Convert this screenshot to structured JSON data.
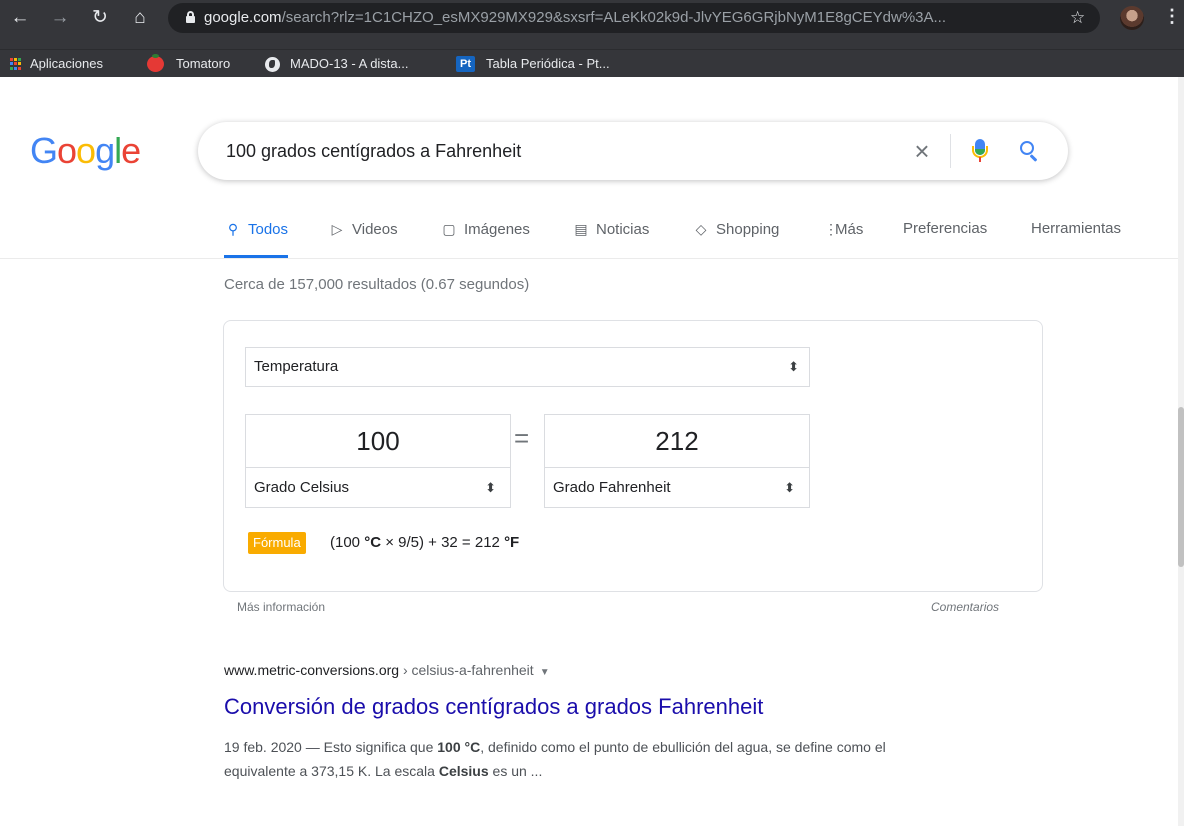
{
  "browser": {
    "url_host": "google.com",
    "url_rest": "/search?rlz=1C1CHZO_esMX929MX929&sxsrf=ALeKk02k9d-JlvYEG6GRjbNyM1E8gCEYdw%3A...",
    "bookmarks": [
      {
        "label": "Aplicaciones",
        "icon": "apps-grid-icon"
      },
      {
        "label": "Tomatoro",
        "icon": "tomato-icon"
      },
      {
        "label": "MADO-13 - A dista...",
        "icon": "globe-icon"
      },
      {
        "label": "Tabla Periódica - Pt...",
        "icon": "pt-logo-icon",
        "logo_text": "Pt"
      }
    ]
  },
  "search": {
    "query": "100 grados centígrados a Fahrenheit"
  },
  "tabs": [
    {
      "label": "Todos",
      "icon": "search-icon",
      "active": true
    },
    {
      "label": "Videos",
      "icon": "play-icon"
    },
    {
      "label": "Imágenes",
      "icon": "image-icon"
    },
    {
      "label": "Noticias",
      "icon": "news-icon"
    },
    {
      "label": "Shopping",
      "icon": "tag-icon"
    },
    {
      "label": "Más",
      "icon": "more-vertical-icon"
    },
    {
      "label": "Preferencias"
    },
    {
      "label": "Herramientas"
    }
  ],
  "result_stats": "Cerca de 157,000 resultados (0.67 segundos)",
  "converter": {
    "category": "Temperatura",
    "from_value": "100",
    "from_unit": "Grado Celsius",
    "to_value": "212",
    "to_unit": "Grado Fahrenheit",
    "equals": "=",
    "formula_label": "Fórmula",
    "formula_pre": "(100 ",
    "formula_unit_c": "°C",
    "formula_mid": " × 9/5) + 32 = 212 ",
    "formula_unit_f": "°F",
    "more_info": "Más información",
    "feedback": "Comentarios"
  },
  "result": {
    "cite_host": "www.metric-conversions.org",
    "cite_path": " › celsius-a-fahrenheit",
    "title": "Conversión de grados centígrados a grados Fahrenheit",
    "snippet_1": "19 feb. 2020 — Esto significa que ",
    "snippet_b1": "100 °C",
    "snippet_2": ", definido como el punto de ebullición del agua, se define como el equivalente a 373,15 K. La escala ",
    "snippet_b2": "Celsius",
    "snippet_3": " es un ..."
  },
  "colors": {
    "link": "#1a0dab",
    "active_tab": "#1a73e8",
    "formula_tag": "#f9ab00",
    "chrome_frame": "#35363a"
  }
}
